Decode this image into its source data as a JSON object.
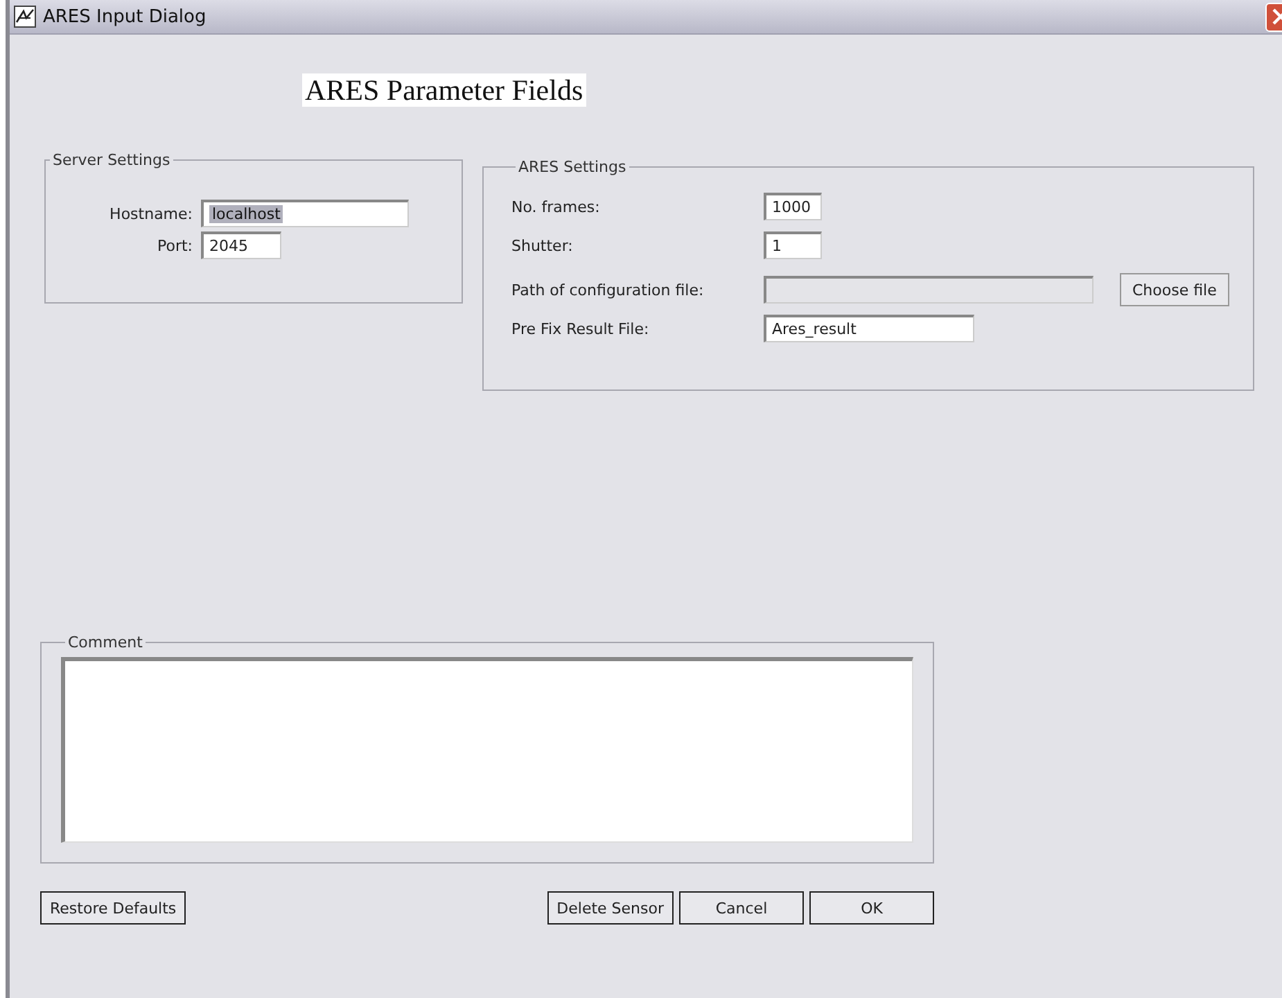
{
  "window": {
    "title": "ARES Input Dialog"
  },
  "heading": "ARES Parameter Fields",
  "server_settings": {
    "title": "Server Settings",
    "fields": [
      {
        "label": "Hostname:",
        "value": "localhost",
        "text_selected": true,
        "disabled": false
      },
      {
        "label": "Port:",
        "value": "2045",
        "text_selected": false,
        "disabled": false
      }
    ]
  },
  "ares_settings": {
    "title": "ARES Settings",
    "fields": [
      {
        "label": "No. frames:",
        "value": "1000",
        "kind": "short",
        "text_selected": false,
        "disabled": false
      },
      {
        "label": "Shutter:",
        "value": "1",
        "kind": "short",
        "text_selected": false,
        "disabled": false
      },
      {
        "label": "Path of configuration file:",
        "kind": "file",
        "text_selected": false,
        "disabled": true,
        "button": "Choose file"
      },
      {
        "label": "Pre Fix Result File:",
        "value": "Ares_result",
        "kind": "medium",
        "text_selected": false,
        "disabled": false
      }
    ]
  },
  "comment": {
    "title": "Comment"
  },
  "buttons": {
    "left": [
      "Restore Defaults"
    ],
    "right": [
      "Delete Sensor",
      "Cancel",
      "OK"
    ]
  }
}
